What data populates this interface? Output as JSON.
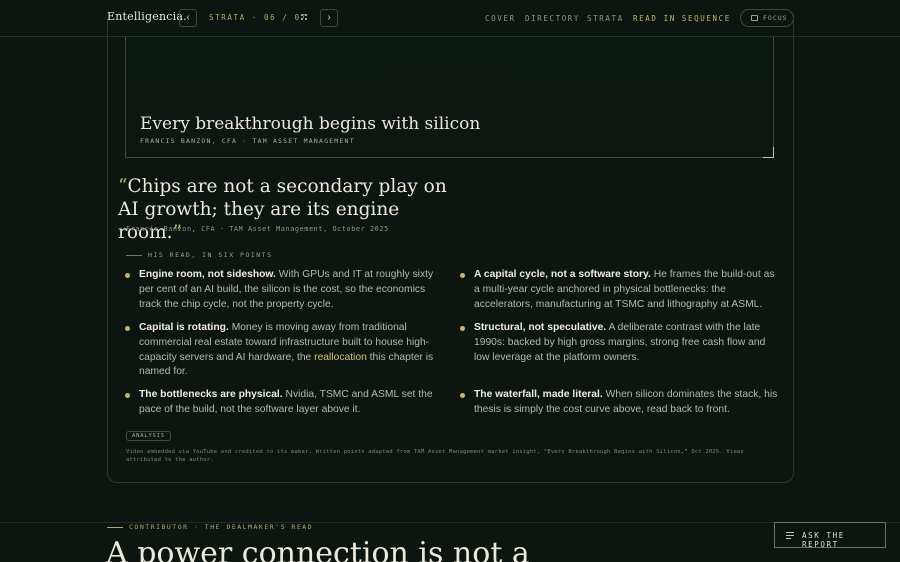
{
  "header": {
    "brand": "Entelligencia.",
    "prev_icon": "chevron-left-icon",
    "next_icon": "chevron-right-icon",
    "strata_position": "STRATA · 06 / 07",
    "grid_icon": "grid-icon",
    "nav": [
      "COVER",
      "DIRECTORY",
      "STRATA",
      "READ IN SEQUENCE"
    ],
    "active_nav": "READ IN SEQUENCE",
    "focus_label": "FOCUS",
    "accent": "#c9b46e"
  },
  "video": {
    "title": "Every breakthrough begins with silicon",
    "credit": "FRANCIS BANZON, CFA · TAM ASSET MANAGEMENT"
  },
  "quote": {
    "open": "“",
    "text": "Chips are not a secondary play on AI growth; they are its engine room.",
    "close": "”",
    "attribution": "Francis Banzon, CFA · TAM Asset Management, October 2025"
  },
  "points_section_label": "HIS READ, IN SIX POINTS",
  "points": [
    {
      "lead": "Engine room, not sideshow.",
      "body": " With GPUs and IT at roughly sixty per cent of an AI build, the silicon is the cost, so the economics track the chip cycle, not the property cycle."
    },
    {
      "lead": "A capital cycle, not a software story.",
      "body": " He frames the build-out as a multi-year cycle anchored in physical bottlenecks: the accelerators, manufacturing at TSMC and lithography at ASML."
    },
    {
      "lead": "Capital is rotating.",
      "body": " Money is moving away from traditional commercial real estate toward infrastructure built to house high-capacity servers and AI hardware, the ",
      "highlight": "reallocation",
      "tail": " this chapter is named for."
    },
    {
      "lead": "Structural, not speculative.",
      "body": " A deliberate contrast with the late 1990s: backed by high gross margins, strong free cash flow and low leverage at the platform owners."
    },
    {
      "lead": "The bottlenecks are physical.",
      "body": " Nvidia, TSMC and ASML set the pace of the build, not the software layer above it."
    },
    {
      "lead": "The waterfall, made literal.",
      "body": " When silicon dominates the stack, his thesis is simply the cost curve above, read back to front."
    }
  ],
  "tag": "ANALYSIS",
  "footnote": "Video embedded via YouTube and credited to its maker. Written points adapted from TAM Asset Management market insight, “Every Breakthrough Begins with Silicon,” Oct 2025. Views attributed to the author.",
  "next_section": {
    "label": "CONTRIBUTOR · THE DEALMAKER'S READ",
    "headline": "A power connection is not a"
  },
  "ask_button": {
    "icon": "menu-lines-icon",
    "label": "ASK THE REPORT"
  }
}
